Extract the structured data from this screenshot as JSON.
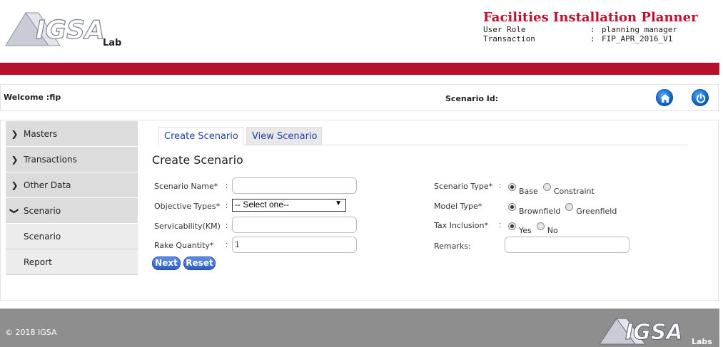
{
  "header": {
    "logo_text": "IGSA",
    "logo_sub": "Labs",
    "app_title": "Facilities Installation Planner",
    "user_role_label": "User Role",
    "user_role_value": "planning manager",
    "transaction_label": "Transaction",
    "transaction_value": "FIP_APR_2016_V1",
    "separator": ":"
  },
  "welcome_bar": {
    "welcome": "Welcome :fip",
    "scenario_id": "Scenario Id:",
    "home_icon": "home-icon",
    "power_icon": "power-icon"
  },
  "sidebar": {
    "items": [
      {
        "label": "Masters",
        "icon": "chevron-right-icon"
      },
      {
        "label": "Transactions",
        "icon": "chevron-right-icon"
      },
      {
        "label": "Other Data",
        "icon": "chevron-right-icon"
      },
      {
        "label": "Scenario",
        "icon": "chevron-down-icon"
      }
    ],
    "subitems": [
      {
        "label": "Scenario"
      },
      {
        "label": "Report"
      }
    ]
  },
  "tabs": [
    {
      "label": "Create Scenario",
      "active": true
    },
    {
      "label": "View Scenario",
      "active": false
    }
  ],
  "form": {
    "title": "Create Scenario",
    "scenario_name_label": "Scenario Name*",
    "scenario_name_value": "",
    "objective_types_label": "Objective Types*",
    "objective_types_value": "-- Select one--",
    "serviceability_label": "Servicability(KM)",
    "serviceability_value": "",
    "rake_quantity_label": "Rake Quantity*",
    "rake_quantity_value": "1",
    "scenario_type_label": "Scenario Type*",
    "scenario_type_options": [
      "Base",
      "Constraint"
    ],
    "scenario_type_selected": "Base",
    "model_type_label": "Model Type*",
    "model_type_options": [
      "Brownfield",
      "Greenfield"
    ],
    "model_type_selected": "Brownfield",
    "tax_inclusion_label": "Tax Inclusion*",
    "tax_inclusion_options": [
      "Yes",
      "No"
    ],
    "tax_inclusion_selected": "Yes",
    "remarks_label": "Remarks:",
    "remarks_value": "",
    "colon": ":",
    "next_label": "Next",
    "reset_label": "Reset"
  },
  "footer": {
    "copyright": "© 2018 IGSA",
    "logo_text": "IGSA",
    "logo_sub": "Labs"
  },
  "colors": {
    "brand_red": "#b7102f",
    "title_red": "#c0102f",
    "link_blue": "#1f3fa8",
    "button_blue": "#2c5ec8",
    "footer_gray": "#8e8e8e"
  }
}
